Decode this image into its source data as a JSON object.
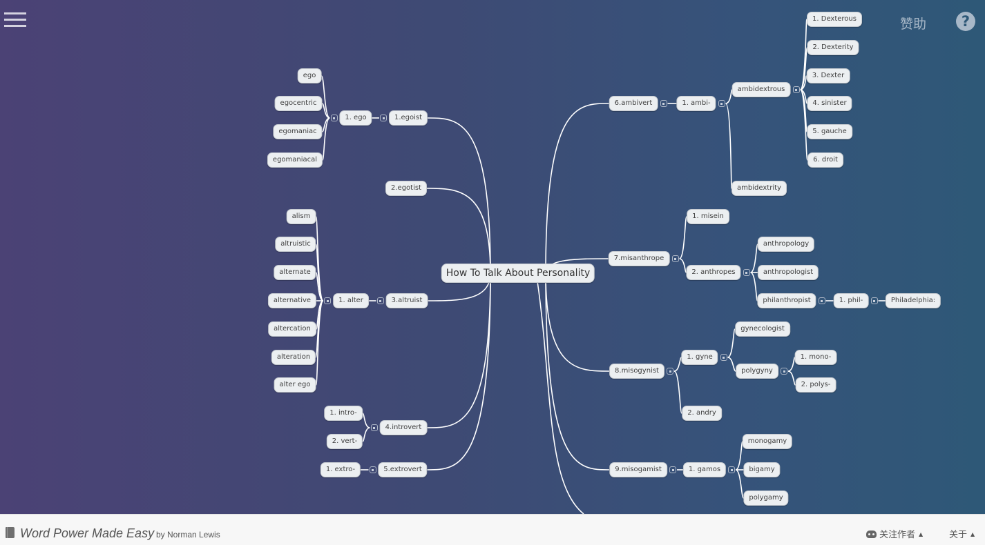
{
  "header": {
    "menu_icon": "hamburger-menu-icon",
    "sponsor_label": "赞助",
    "help_icon": "question-circle-icon",
    "help_glyph": "?"
  },
  "mindmap": {
    "root": "How To Talk About Personality",
    "nodes": [
      {
        "id": "n1",
        "label": "1.egoist",
        "parent": "root",
        "side": "left"
      },
      {
        "id": "n1a",
        "label": "1. ego",
        "parent": "n1",
        "side": "left"
      },
      {
        "id": "n1a1",
        "label": "ego",
        "parent": "n1a",
        "side": "left"
      },
      {
        "id": "n1a2",
        "label": "egocentric",
        "parent": "n1a",
        "side": "left"
      },
      {
        "id": "n1a3",
        "label": "egomaniac",
        "parent": "n1a",
        "side": "left"
      },
      {
        "id": "n1a4",
        "label": "egomaniacal",
        "parent": "n1a",
        "side": "left"
      },
      {
        "id": "n2",
        "label": "2.egotist",
        "parent": "root",
        "side": "left"
      },
      {
        "id": "n3",
        "label": "3.altruist",
        "parent": "root",
        "side": "left"
      },
      {
        "id": "n3a",
        "label": "1. alter",
        "parent": "n3",
        "side": "left"
      },
      {
        "id": "n3a1",
        "label": "alism",
        "parent": "n3a",
        "side": "left"
      },
      {
        "id": "n3a2",
        "label": "altruistic",
        "parent": "n3a",
        "side": "left"
      },
      {
        "id": "n3a3",
        "label": "alternate",
        "parent": "n3a",
        "side": "left"
      },
      {
        "id": "n3a4",
        "label": "alternative",
        "parent": "n3a",
        "side": "left"
      },
      {
        "id": "n3a5",
        "label": "altercation",
        "parent": "n3a",
        "side": "left"
      },
      {
        "id": "n3a6",
        "label": "alteration",
        "parent": "n3a",
        "side": "left"
      },
      {
        "id": "n3a7",
        "label": "alter ego",
        "parent": "n3a",
        "side": "left"
      },
      {
        "id": "n4",
        "label": "4.introvert",
        "parent": "root",
        "side": "left"
      },
      {
        "id": "n4a",
        "label": "1. intro-",
        "parent": "n4",
        "side": "left"
      },
      {
        "id": "n4b",
        "label": "2. vert-",
        "parent": "n4",
        "side": "left"
      },
      {
        "id": "n5",
        "label": "5.extrovert",
        "parent": "root",
        "side": "left"
      },
      {
        "id": "n5a",
        "label": "1. extro-",
        "parent": "n5",
        "side": "left"
      },
      {
        "id": "n6",
        "label": "6.ambivert",
        "parent": "root",
        "side": "right"
      },
      {
        "id": "n6a",
        "label": "1. ambi-",
        "parent": "n6",
        "side": "right"
      },
      {
        "id": "n6a1",
        "label": "ambidextrous",
        "parent": "n6a",
        "side": "right"
      },
      {
        "id": "n6a1a",
        "label": "1. Dexterous",
        "parent": "n6a1",
        "side": "right"
      },
      {
        "id": "n6a1b",
        "label": "2. Dexterity",
        "parent": "n6a1",
        "side": "right"
      },
      {
        "id": "n6a1c",
        "label": "3. Dexter",
        "parent": "n6a1",
        "side": "right"
      },
      {
        "id": "n6a1d",
        "label": "4. sinister",
        "parent": "n6a1",
        "side": "right"
      },
      {
        "id": "n6a1e",
        "label": "5. gauche",
        "parent": "n6a1",
        "side": "right"
      },
      {
        "id": "n6a1f",
        "label": "6. droit",
        "parent": "n6a1",
        "side": "right"
      },
      {
        "id": "n6a2",
        "label": "ambidextrity",
        "parent": "n6a",
        "side": "right"
      },
      {
        "id": "n7",
        "label": "7.misanthrope",
        "parent": "root",
        "side": "right"
      },
      {
        "id": "n7a",
        "label": "1. misein",
        "parent": "n7",
        "side": "right"
      },
      {
        "id": "n7b",
        "label": "2. anthropes",
        "parent": "n7",
        "side": "right"
      },
      {
        "id": "n7b1",
        "label": "anthropology",
        "parent": "n7b",
        "side": "right"
      },
      {
        "id": "n7b2",
        "label": "anthropologist",
        "parent": "n7b",
        "side": "right"
      },
      {
        "id": "n7b3",
        "label": "philanthropist",
        "parent": "n7b",
        "side": "right"
      },
      {
        "id": "n7b3a",
        "label": "1. phil-",
        "parent": "n7b3",
        "side": "right"
      },
      {
        "id": "n7b3a1",
        "label": "Philadelphia:",
        "parent": "n7b3a",
        "side": "right"
      },
      {
        "id": "n8",
        "label": "8.misogynist",
        "parent": "root",
        "side": "right"
      },
      {
        "id": "n8a",
        "label": "1. gyne",
        "parent": "n8",
        "side": "right"
      },
      {
        "id": "n8a1",
        "label": "gynecologist",
        "parent": "n8a",
        "side": "right"
      },
      {
        "id": "n8a2",
        "label": "polygyny",
        "parent": "n8a",
        "side": "right"
      },
      {
        "id": "n8a2a",
        "label": "1. mono-",
        "parent": "n8a2",
        "side": "right"
      },
      {
        "id": "n8a2b",
        "label": "2. polys-",
        "parent": "n8a2",
        "side": "right"
      },
      {
        "id": "n8b",
        "label": "2. andry",
        "parent": "n8",
        "side": "right"
      },
      {
        "id": "n9",
        "label": "9.misogamist",
        "parent": "root",
        "side": "right"
      },
      {
        "id": "n9a",
        "label": "1. gamos",
        "parent": "n9",
        "side": "right"
      },
      {
        "id": "n9a1",
        "label": "monogamy",
        "parent": "n9a",
        "side": "right"
      },
      {
        "id": "n9a2",
        "label": "bigamy",
        "parent": "n9a",
        "side": "right"
      },
      {
        "id": "n9a3",
        "label": "polygamy",
        "parent": "n9a",
        "side": "right"
      }
    ]
  },
  "footer": {
    "book_icon": "book-icon",
    "title": "Word Power Made Easy",
    "author": "by Norman Lewis",
    "follow_icon": "github-icon",
    "follow_label": "关注作者",
    "about_label": "关于",
    "caret": "▲"
  }
}
